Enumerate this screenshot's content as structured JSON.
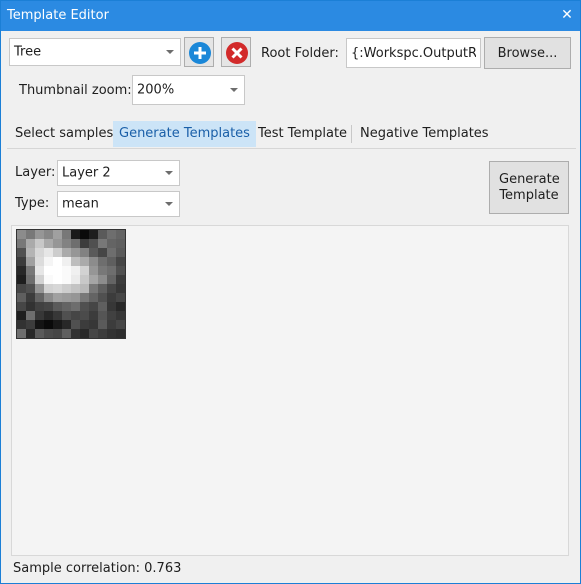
{
  "window": {
    "title": "Template Editor",
    "close_glyph": "✕"
  },
  "toolbar": {
    "class_select_value": "Tree",
    "add_icon": "plus-circle-icon",
    "remove_icon": "x-circle-icon",
    "add_color": "#1a87d8",
    "remove_color": "#d22a2a",
    "root_folder_label": "Root Folder:",
    "root_folder_value": "{:Workspc.OutputRoot}",
    "browse_label": "Browse..."
  },
  "zoom": {
    "label": "Thumbnail zoom:",
    "value": "200%"
  },
  "tabs": [
    {
      "label": "Select samples",
      "active": false
    },
    {
      "label": "Generate Templates",
      "active": true
    },
    {
      "label": "Test Template",
      "active": false
    },
    {
      "label": "Negative Templates",
      "active": false
    }
  ],
  "generate": {
    "layer_label": "Layer:",
    "layer_value": "Layer 2",
    "type_label": "Type:",
    "type_value": "mean",
    "generate_button": "Generate Template"
  },
  "template_thumbnail": {
    "grid_size": 12,
    "pixels": [
      [
        140,
        120,
        150,
        135,
        160,
        120,
        25,
        10,
        30,
        90,
        110,
        100
      ],
      [
        120,
        170,
        200,
        170,
        150,
        130,
        110,
        60,
        80,
        120,
        100,
        95
      ],
      [
        80,
        180,
        215,
        230,
        205,
        170,
        150,
        130,
        90,
        70,
        110,
        90
      ],
      [
        60,
        160,
        220,
        245,
        255,
        240,
        190,
        170,
        140,
        110,
        95,
        70
      ],
      [
        40,
        120,
        230,
        255,
        255,
        250,
        240,
        210,
        150,
        120,
        110,
        80
      ],
      [
        30,
        110,
        210,
        250,
        255,
        250,
        235,
        200,
        165,
        140,
        100,
        60
      ],
      [
        70,
        80,
        150,
        210,
        215,
        205,
        195,
        185,
        120,
        95,
        70,
        55
      ],
      [
        95,
        60,
        100,
        140,
        160,
        155,
        150,
        120,
        100,
        80,
        60,
        70
      ],
      [
        70,
        50,
        65,
        70,
        90,
        100,
        110,
        80,
        70,
        95,
        55,
        40
      ],
      [
        30,
        110,
        55,
        40,
        55,
        80,
        70,
        75,
        60,
        85,
        65,
        55
      ],
      [
        50,
        60,
        20,
        10,
        25,
        40,
        80,
        60,
        55,
        90,
        60,
        70
      ],
      [
        110,
        40,
        90,
        75,
        70,
        95,
        50,
        40,
        70,
        60,
        50,
        45
      ]
    ]
  },
  "status": {
    "label": "Sample correlation: 0.763"
  }
}
